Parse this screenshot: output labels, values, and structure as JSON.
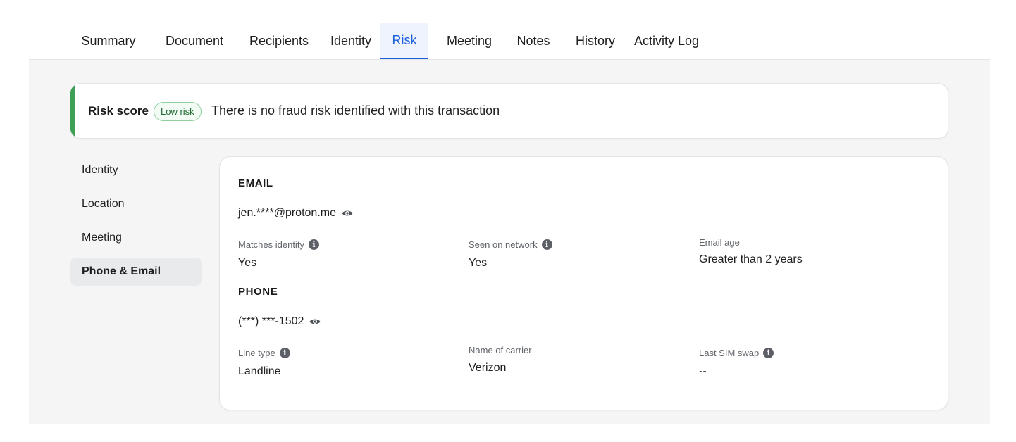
{
  "tabs": [
    {
      "label": "Summary"
    },
    {
      "label": "Document"
    },
    {
      "label": "Recipients"
    },
    {
      "label": "Identity"
    },
    {
      "label": "Risk",
      "active": true
    },
    {
      "label": "Meeting"
    },
    {
      "label": "Notes"
    },
    {
      "label": "History"
    },
    {
      "label": "Activity Log"
    }
  ],
  "risk": {
    "title": "Risk score",
    "badge": "Low risk",
    "message": "There is no fraud risk identified with this transaction",
    "accent_color": "#3e9f57"
  },
  "sidebar": {
    "items": [
      {
        "label": "Identity"
      },
      {
        "label": "Location"
      },
      {
        "label": "Meeting"
      },
      {
        "label": "Phone & Email",
        "active": true
      }
    ]
  },
  "email": {
    "heading": "EMAIL",
    "value": "jen.****@proton.me",
    "reveal_icon": "eye-icon",
    "fields": [
      {
        "label": "Matches identity",
        "value": "Yes",
        "info": true
      },
      {
        "label": "Seen on network",
        "value": "Yes",
        "info": true
      },
      {
        "label": "Email age",
        "value": "Greater than 2 years",
        "info": false
      }
    ]
  },
  "phone": {
    "heading": "PHONE",
    "value": "(***) ***-1502",
    "reveal_icon": "eye-icon",
    "fields": [
      {
        "label": "Line type",
        "value": "Landline",
        "info": true
      },
      {
        "label": "Name of carrier",
        "value": "Verizon",
        "info": false
      },
      {
        "label": "Last SIM swap",
        "value": "--",
        "info": true
      }
    ]
  },
  "colors": {
    "active_tab": "#1d5fd8",
    "page_background": "#f5f5f6"
  }
}
